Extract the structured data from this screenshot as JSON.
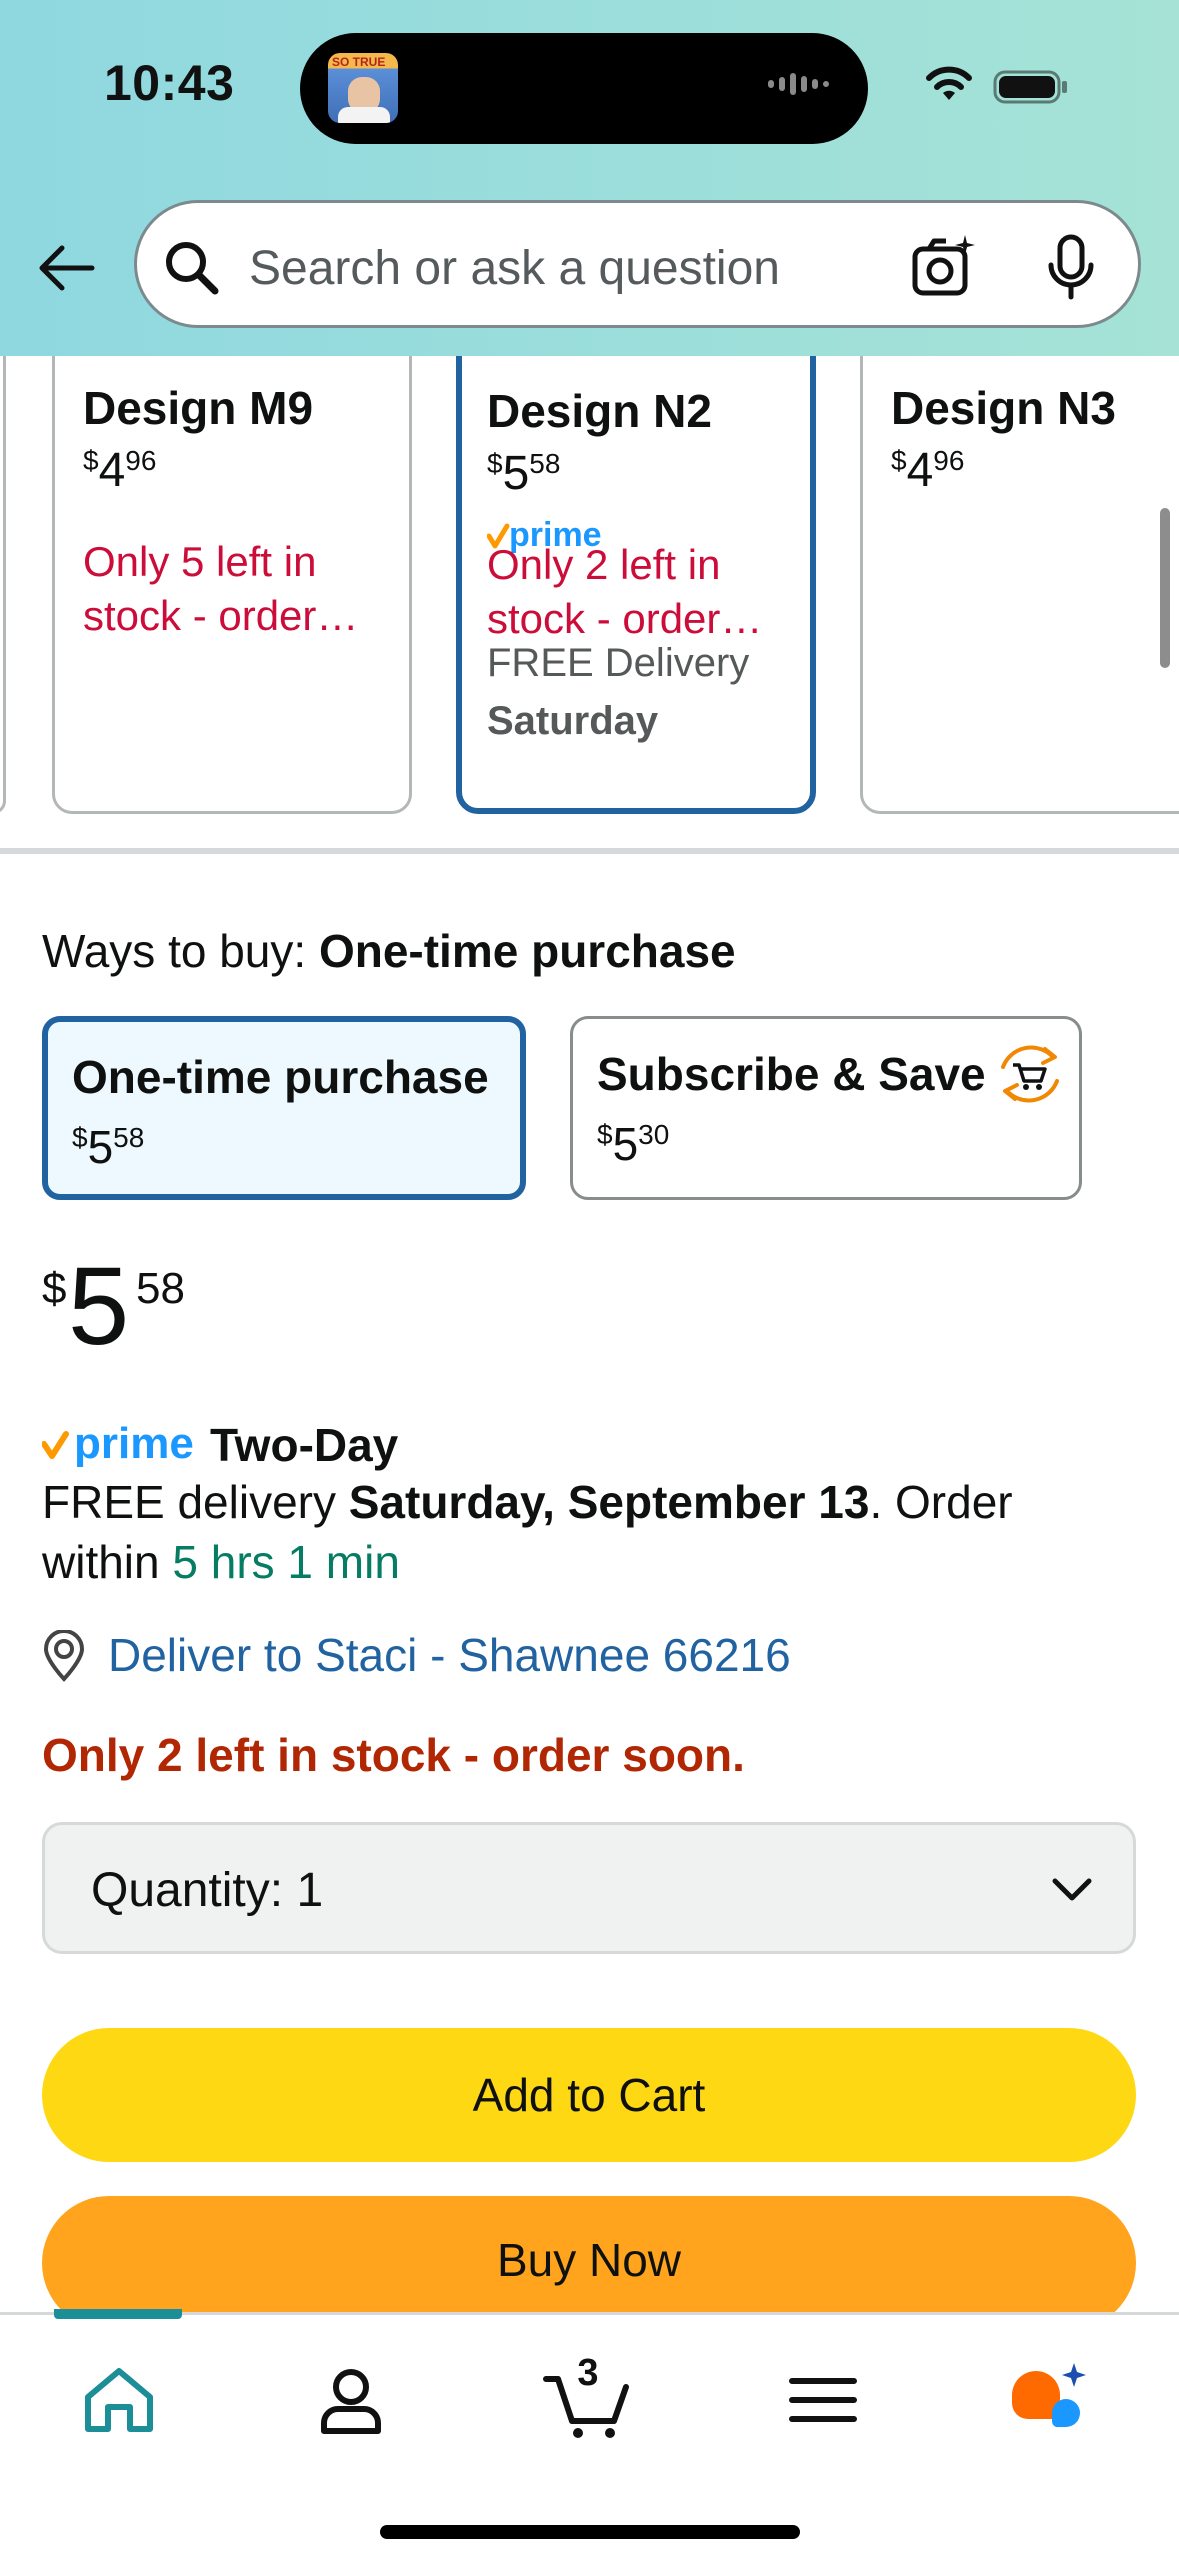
{
  "status_bar": {
    "time": "10:43",
    "island_tag": "SO TRUE"
  },
  "header": {
    "search_placeholder": "Search or ask a question",
    "icons": [
      "back-arrow-icon",
      "search-icon",
      "camera-icon",
      "microphone-icon"
    ]
  },
  "variants": [
    {
      "name": "Design M9",
      "price_whole": "$",
      "price_main": "4",
      "price_frac": "96",
      "prime": false,
      "stock_line1": "Only 5 left in",
      "stock_line2": "stock - order…",
      "delivery_line1": "",
      "delivery_line2": "",
      "selected": false
    },
    {
      "name": "Design N2",
      "price_whole": "$",
      "price_main": "5",
      "price_frac": "58",
      "prime": true,
      "stock_line1": "Only 2 left in",
      "stock_line2": "stock - order…",
      "delivery_line1": "FREE Delivery",
      "delivery_line2": "Saturday",
      "selected": true
    },
    {
      "name": "Design N3",
      "price_whole": "$",
      "price_main": "4",
      "price_frac": "96",
      "prime": false,
      "stock_line1": "",
      "stock_line2": "",
      "delivery_line1": "",
      "delivery_line2": "",
      "selected": false
    }
  ],
  "ways_to_buy": {
    "label": "Ways to buy:",
    "selected_value": "One-time purchase",
    "options": [
      {
        "title": "One-time purchase",
        "cur": "$",
        "main": "5",
        "frac": "58",
        "selected": true
      },
      {
        "title": "Subscribe & Save",
        "cur": "$",
        "main": "5",
        "frac": "30",
        "selected": false
      }
    ]
  },
  "price": {
    "currency": "$",
    "whole": "5",
    "fraction": "58"
  },
  "prime_delivery": {
    "prime_word": "prime",
    "speed": "Two-Day",
    "free_delivery": "FREE delivery ",
    "date": "Saturday, September 13",
    "order_within_prefix": ". Order within ",
    "countdown": "5 hrs 1 min"
  },
  "deliver_to": "Deliver to Staci - Shawnee 66216",
  "stock_message": "Only 2 left in stock - order soon.",
  "quantity": {
    "label": "Quantity:",
    "value": "1"
  },
  "buttons": {
    "add_to_cart": "Add to Cart",
    "buy_now": "Buy Now"
  },
  "bottom_nav": {
    "cart_count": "3",
    "items": [
      "home-icon",
      "account-icon",
      "cart-icon",
      "menu-icon",
      "rufus-assistant-icon"
    ],
    "active": "home-icon"
  },
  "colors": {
    "header_gradient_start": "#8fd8e0",
    "header_gradient_end": "#a6e3d6",
    "selected_border": "#2162a1",
    "stock_red": "#cc0c39",
    "add_to_cart": "#ffd814",
    "buy_now": "#ffa41c",
    "countdown_green": "#067d62",
    "link_blue": "#2162a1"
  }
}
